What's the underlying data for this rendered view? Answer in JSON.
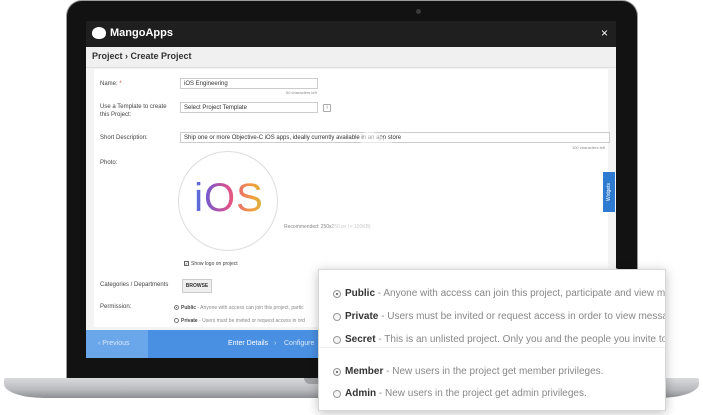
{
  "app": {
    "brand": "MangoApps",
    "close_symbol": "×"
  },
  "page": {
    "title": "Project › Create Project"
  },
  "form": {
    "name": {
      "label": "Name:",
      "required_mark": "*",
      "value": "iOS Engineering",
      "hint": "50 characters left"
    },
    "template": {
      "label_line1": "Use a Template to create",
      "label_line2": "this Project:",
      "value": "Select Project Template",
      "info_symbol": "i"
    },
    "short_description": {
      "label": "Short Description:",
      "value": "Ship one or more Objective-C iOS apps, ideally currently available in an app store",
      "hint": "100 characters left"
    },
    "photo": {
      "label": "Photo:",
      "logo_text": "iOS",
      "recommended": "Recommended: 250x250 px (< 100KB)",
      "show_logo_label": "Show logo on project",
      "show_logo_checked": true
    },
    "categories": {
      "label": "Categories / Departments",
      "browse_label": "BROWSE"
    },
    "permission": {
      "label": "Permission:",
      "options": [
        {
          "name": "Public",
          "text": " - Anyone with access can join this project, partic",
          "checked": true
        },
        {
          "name": "Private",
          "text": " - Users must be invited or request access in ord",
          "checked": false
        }
      ]
    }
  },
  "widgets_tab": {
    "label": "Widgets"
  },
  "footer": {
    "prev_label": "‹ Previous",
    "step1": "Enter Details",
    "separator": "›",
    "step2": "Configure"
  },
  "zoom": {
    "permissions": [
      {
        "name": "Public",
        "text": " - Anyone with access can join this project, participate and view me",
        "checked": true
      },
      {
        "name": "Private",
        "text": " - Users must be invited or request access in order to view message",
        "checked": false
      },
      {
        "name": "Secret",
        "text": " - This is an unlisted project. Only you and the people you invite to",
        "checked": false
      }
    ],
    "roles": [
      {
        "name": "Member",
        "text": " - New users in the project get member privileges.",
        "checked": true
      },
      {
        "name": "Admin",
        "text": " - New users in the project get admin privileges.",
        "checked": false
      }
    ]
  }
}
